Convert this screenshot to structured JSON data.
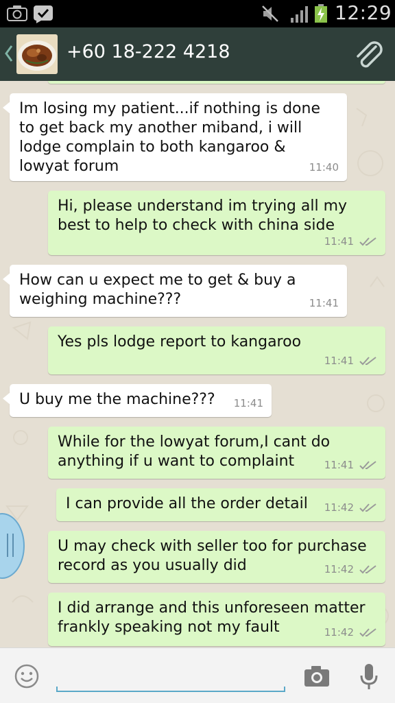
{
  "status_bar": {
    "time": "12:29",
    "icons": [
      "camera-icon",
      "check-badge-icon",
      "mute-icon",
      "signal-icon",
      "battery-charging-icon"
    ]
  },
  "header": {
    "back_icon": "chevron-left-icon",
    "contact_name": "+60 18-222 4218",
    "attach_icon": "paperclip-icon"
  },
  "messages": [
    {
      "direction": "in",
      "text": "Im losing my patient...if nothing is done\nto get back my another miband, i will\nlodge complain to both kangaroo &\nlowyat forum",
      "time": "11:40"
    },
    {
      "direction": "out",
      "text": "Hi, please understand im trying all my\nbest to help to check with china side",
      "time": "11:41"
    },
    {
      "direction": "in",
      "text": "How can u expect me to get & buy a\nweighing machine???",
      "time": "11:41"
    },
    {
      "direction": "out",
      "text": "Yes pls lodge report to kangaroo",
      "time": "11:41"
    },
    {
      "direction": "in",
      "text": "U buy me the machine???",
      "time": "11:41"
    },
    {
      "direction": "out",
      "text": "While for the lowyat forum,I cant do\nanything if u want to complaint",
      "time": "11:41"
    },
    {
      "direction": "out",
      "text": "I can provide all the order detail",
      "time": "11:42"
    },
    {
      "direction": "out",
      "text": "U may check with seller too for purchase\nrecord as you usually did",
      "time": "11:42"
    },
    {
      "direction": "out",
      "text": "I did arrange and this unforeseen matter\nfrankly speaking not my fault",
      "time": "11:42"
    }
  ],
  "input_bar": {
    "emoji_icon": "smiley-icon",
    "message_value": "",
    "camera_icon": "camera-icon",
    "mic_icon": "microphone-icon"
  },
  "colors": {
    "header_bg": "#2f3f3a",
    "incoming_bubble": "#ffffff",
    "outgoing_bubble": "#dcf8c6",
    "chat_bg": "#e5dfd3",
    "input_underline": "#5aa8c8"
  }
}
